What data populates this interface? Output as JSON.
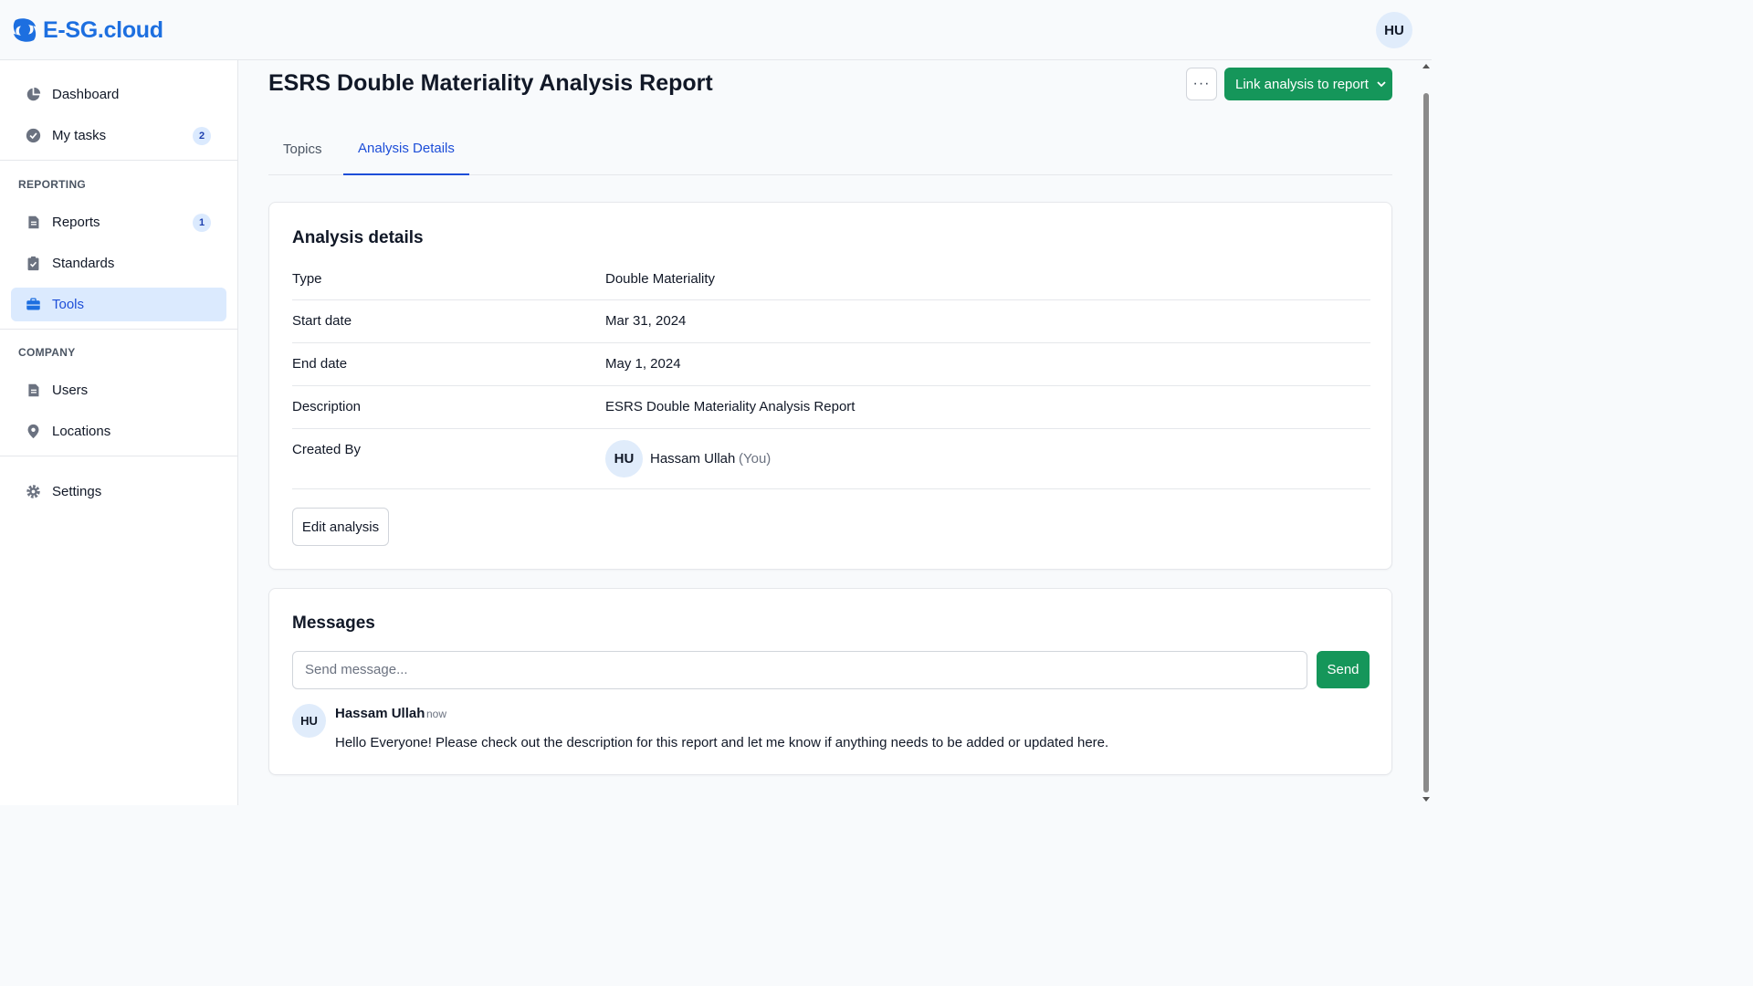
{
  "app": {
    "logo_text": "E-SG.cloud",
    "user_initials": "HU"
  },
  "sidebar": {
    "items_top": [
      {
        "label": "Dashboard",
        "icon": "pie-chart-icon"
      },
      {
        "label": "My tasks",
        "icon": "check-circle-icon",
        "badge": "2"
      }
    ],
    "reporting_label": "REPORTING",
    "reporting_items": [
      {
        "label": "Reports",
        "icon": "document-icon",
        "badge": "1"
      },
      {
        "label": "Standards",
        "icon": "clipboard-check-icon"
      },
      {
        "label": "Tools",
        "icon": "briefcase-icon",
        "active": true
      }
    ],
    "company_label": "COMPANY",
    "company_items": [
      {
        "label": "Users",
        "icon": "document-icon"
      },
      {
        "label": "Locations",
        "icon": "map-pin-icon"
      }
    ],
    "settings": {
      "label": "Settings",
      "icon": "gear-icon"
    }
  },
  "header": {
    "title": "ESRS Double Materiality Analysis Report",
    "more_label": "···",
    "link_button_label": "Link analysis to report"
  },
  "tabs": [
    {
      "label": "Topics",
      "active": false
    },
    {
      "label": "Analysis Details",
      "active": true
    }
  ],
  "details": {
    "title": "Analysis details",
    "rows": [
      {
        "label": "Type",
        "value": "Double Materiality"
      },
      {
        "label": "Start date",
        "value": "Mar 31, 2024"
      },
      {
        "label": "End date",
        "value": "May 1, 2024"
      },
      {
        "label": "Description",
        "value": "ESRS Double Materiality Analysis Report"
      }
    ],
    "created_by_label": "Created By",
    "creator": {
      "initials": "HU",
      "name": "Hassam Ullah",
      "suffix": "(You)"
    },
    "edit_button": "Edit analysis"
  },
  "messages": {
    "title": "Messages",
    "input_placeholder": "Send message...",
    "send_button": "Send",
    "items": [
      {
        "initials": "HU",
        "author": "Hassam Ullah",
        "time": "now",
        "text": "Hello Everyone! Please check out the description for this report and let me know if anything needs to be added or updated here."
      }
    ]
  },
  "colors": {
    "brand": "#1d6fe0",
    "primary_green": "#15965a",
    "active_blue": "#1d4ed8",
    "active_bg": "#dbeafe"
  }
}
